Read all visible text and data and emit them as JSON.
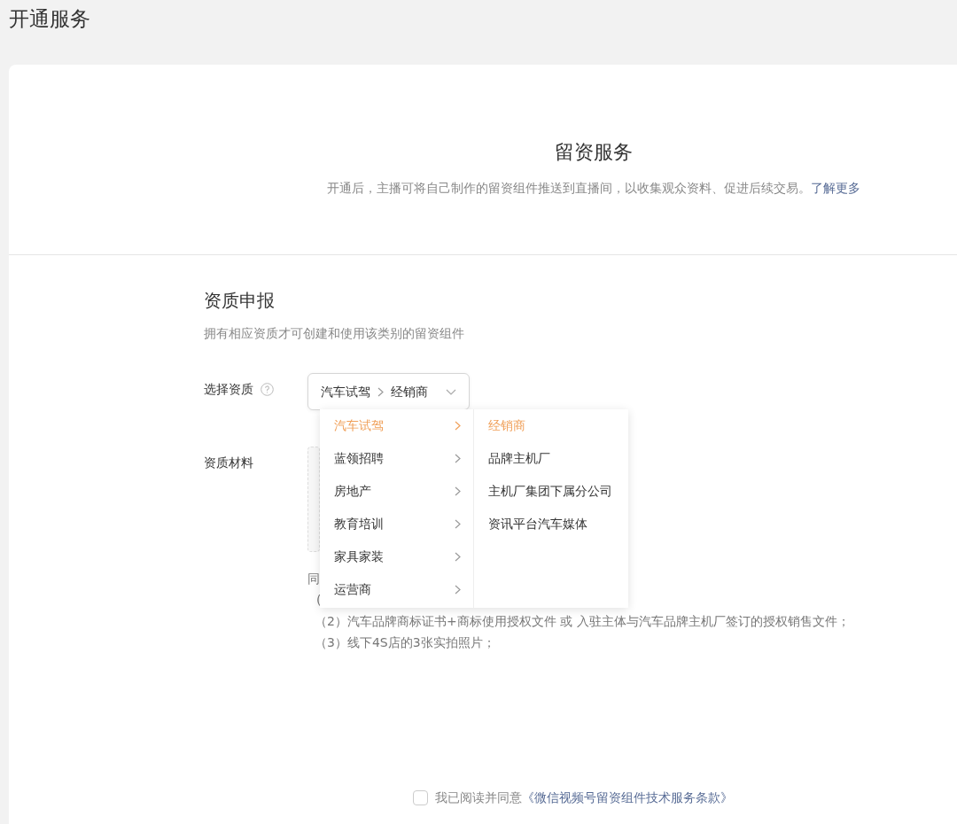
{
  "page_title": "开通服务",
  "service": {
    "title": "留资服务",
    "description": "开通后，主播可将自己制作的留资组件推送到直播间，以收集观众资料、促进后续交易。",
    "link": "了解更多"
  },
  "qualification": {
    "title": "资质申报",
    "subtitle": "拥有相应资质才可创建和使用该类别的留资组件",
    "select_label": "选择资质",
    "selected_path": [
      "汽车试驾",
      "经销商"
    ],
    "materials_label": "资质材料",
    "notes": [
      "同",
      "(",
      "（2）汽车品牌商标证书+商标使用授权文件 或 入驻主体与汽车品牌主机厂签订的授权销售文件；",
      "（3）线下4S店的3张实拍照片；"
    ]
  },
  "cascader": {
    "expanded": true,
    "categories": [
      {
        "label": "汽车试驾",
        "selected": true
      },
      {
        "label": "蓝领招聘",
        "selected": false
      },
      {
        "label": "房地产",
        "selected": false
      },
      {
        "label": "教育培训",
        "selected": false
      },
      {
        "label": "家具家装",
        "selected": false
      },
      {
        "label": "运营商",
        "selected": false
      }
    ],
    "subcategories": [
      {
        "label": "经销商",
        "selected": true
      },
      {
        "label": "品牌主机厂",
        "selected": false
      },
      {
        "label": "主机厂集团下属分公司",
        "selected": false
      },
      {
        "label": "资讯平台汽车媒体",
        "selected": false
      }
    ]
  },
  "agreement": {
    "checked": false,
    "text": "我已阅读并同意",
    "link": "《微信视频号留资组件技术服务条款》"
  }
}
